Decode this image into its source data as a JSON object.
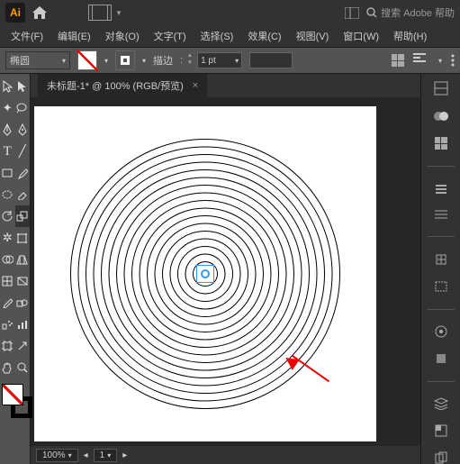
{
  "app": {
    "logo": "Ai"
  },
  "search": {
    "placeholder": "搜索 Adobe 帮助"
  },
  "menu": [
    {
      "label": "文件(F)"
    },
    {
      "label": "编辑(E)"
    },
    {
      "label": "对象(O)"
    },
    {
      "label": "文字(T)"
    },
    {
      "label": "选择(S)"
    },
    {
      "label": "效果(C)"
    },
    {
      "label": "视图(V)"
    },
    {
      "label": "窗口(W)"
    },
    {
      "label": "帮助(H)"
    }
  ],
  "control": {
    "shape": "椭圆",
    "stroke_label": "描边",
    "stroke_pt": "1 pt"
  },
  "tab": {
    "title": "未标题-1* @ 100% (RGB/预览)"
  },
  "status": {
    "zoom": "100%",
    "artboard": "1"
  }
}
